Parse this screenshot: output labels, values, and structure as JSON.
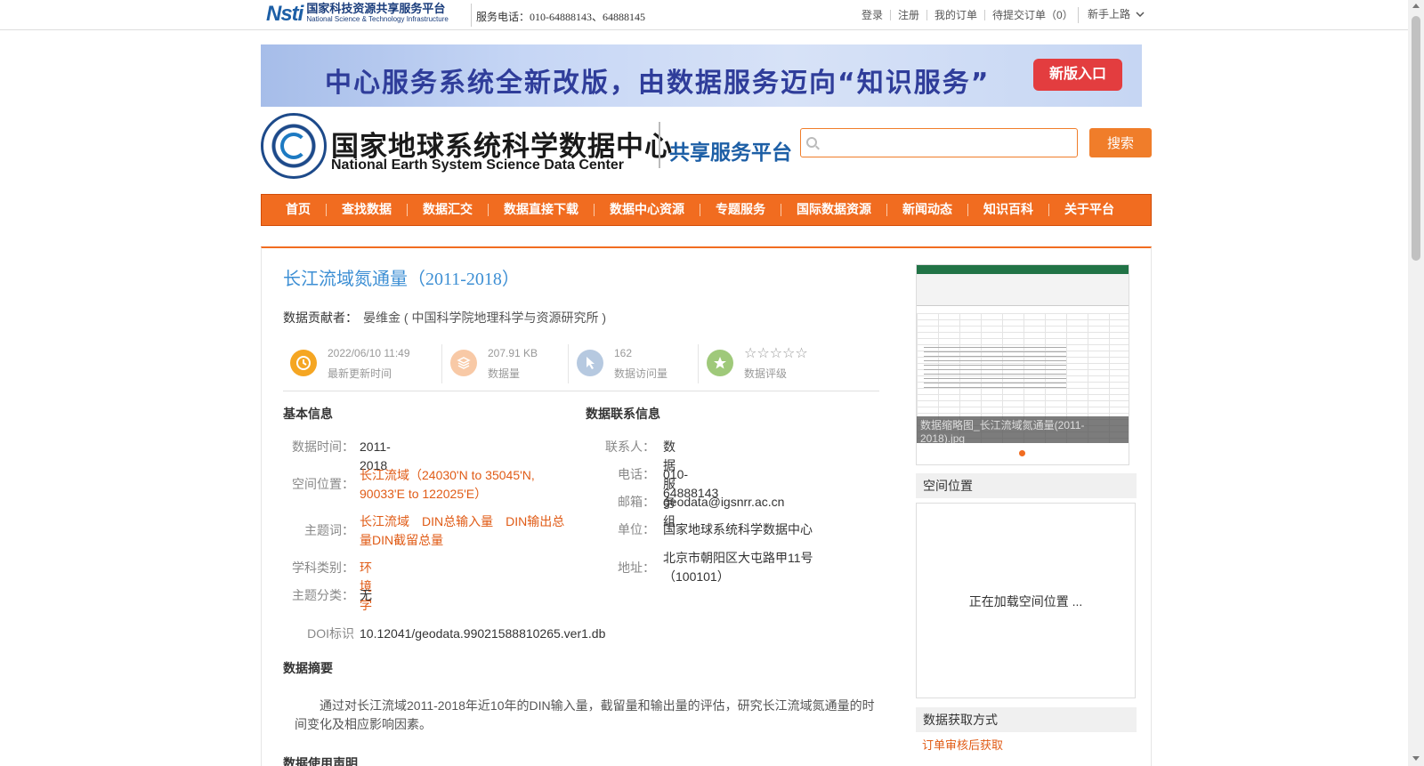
{
  "topbar": {
    "logo_mark": "Nsti",
    "logo_cn": "国家科技资源共享服务平台",
    "logo_en": "National Science & Technology Infrastructure",
    "service_phone": "服务电话：010-64888143、64888145",
    "links": [
      "登录",
      "注册",
      "我的订单",
      "待提交订单（0）"
    ],
    "newbie": "新手上路"
  },
  "banner": {
    "text": "中心服务系统全新改版，由数据服务迈向“知识服务”",
    "button": "新版入口"
  },
  "header": {
    "title_cn": "国家地球系统科学数据中心",
    "title_en": "National Earth System Science Data Center",
    "platform": "共享服务平台",
    "search_placeholder": "",
    "search_button": "搜索"
  },
  "nav": [
    "首页",
    "查找数据",
    "数据汇交",
    "数据直接下载",
    "数据中心资源",
    "专题服务",
    "国际数据资源",
    "新闻动态",
    "知识百科",
    "关于平台"
  ],
  "dataset": {
    "title": "长江流域氮通量（2011-2018）",
    "contributor_label": "数据贡献者：",
    "contributor": "晏维金 ( 中国科学院地理科学与资源研究所 )",
    "stats": {
      "updated": {
        "value": "2022/06/10 11:49",
        "label": "最新更新时间"
      },
      "size": {
        "value": "207.91 KB",
        "label": "数据量"
      },
      "visits": {
        "value": "162",
        "label": "数据访问量"
      },
      "rating": {
        "stars": "☆☆☆☆☆",
        "label": "数据评级",
        "score": 0
      }
    },
    "basic_head": "基本信息",
    "contact_head": "数据联系信息",
    "basic": {
      "time_label": "数据时间：",
      "time": "2011-2018",
      "location_label": "空间位置：",
      "location": "长江流域（24030'N to 35045'N, 90033'E to 122025'E）",
      "keywords_label": "主题词：",
      "keywords": "长江流域　DIN总输入量　DIN输出总量DIN截留总量",
      "discipline_label": "学科类别：",
      "discipline": "环境学",
      "category_label": "主题分类：",
      "category": "无",
      "doi_label": "DOI标识",
      "doi": "10.12041/geodata.99021588810265.ver1.db"
    },
    "contact": {
      "person_label": "联系人：",
      "person": "数据服务组",
      "phone_label": "电话：",
      "phone": "010-64888143",
      "email_label": "邮箱：",
      "email": "geodata@igsnrr.ac.cn",
      "unit_label": "单位：",
      "unit": "国家地球系统科学数据中心",
      "address_label": "地址：",
      "address": "北京市朝阳区大屯路甲11号（100101）"
    },
    "abstract_head": "数据摘要",
    "abstract": "通过对长江流域2011-2018年近10年的DIN输入量，截留量和输出量的评估，研究长江流域氮通量的时间变化及相应影响因素。",
    "usage_head": "数据使用声明"
  },
  "sidebar": {
    "thumb_caption": "数据缩略图_长江流域氮通量(2011-2018).jpg",
    "spatial_head": "空间位置",
    "spatial_loading": "正在加载空间位置 ...",
    "acquire_head": "数据获取方式",
    "acquire": "订单审核后获取"
  },
  "colors": {
    "accent": "#f16c20",
    "title_blue": "#3d8fd4",
    "link_orange": "#e05b16"
  },
  "icons": {
    "updated": "clock-icon",
    "size": "database-icon",
    "visits": "cursor-icon",
    "rating": "star-icon"
  }
}
